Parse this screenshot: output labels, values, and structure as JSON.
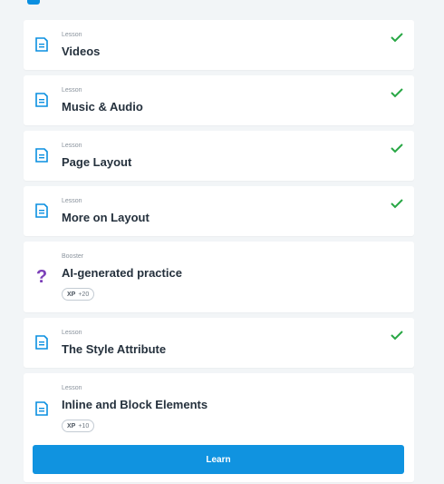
{
  "colors": {
    "accent": "#1093e0",
    "check": "#28a745",
    "booster": "#7b3fb8",
    "title": "#25313d"
  },
  "items": [
    {
      "type": "Lesson",
      "title": "Videos",
      "completed": true,
      "icon": "lesson-document-icon"
    },
    {
      "type": "Lesson",
      "title": "Music & Audio",
      "completed": true,
      "icon": "lesson-document-icon"
    },
    {
      "type": "Lesson",
      "title": "Page Layout",
      "completed": true,
      "icon": "lesson-document-icon"
    },
    {
      "type": "Lesson",
      "title": "More on Layout",
      "completed": true,
      "icon": "lesson-document-icon"
    },
    {
      "type": "Booster",
      "title": "AI-generated practice",
      "completed": false,
      "icon": "question-mark-icon",
      "xp_label": "XP",
      "xp_value": "+20"
    },
    {
      "type": "Lesson",
      "title": "The Style Attribute",
      "completed": true,
      "icon": "lesson-document-icon"
    },
    {
      "type": "Lesson",
      "title": "Inline and Block Elements",
      "completed": false,
      "icon": "lesson-document-icon",
      "xp_label": "XP",
      "xp_value": "+10",
      "button_label": "Learn"
    }
  ]
}
